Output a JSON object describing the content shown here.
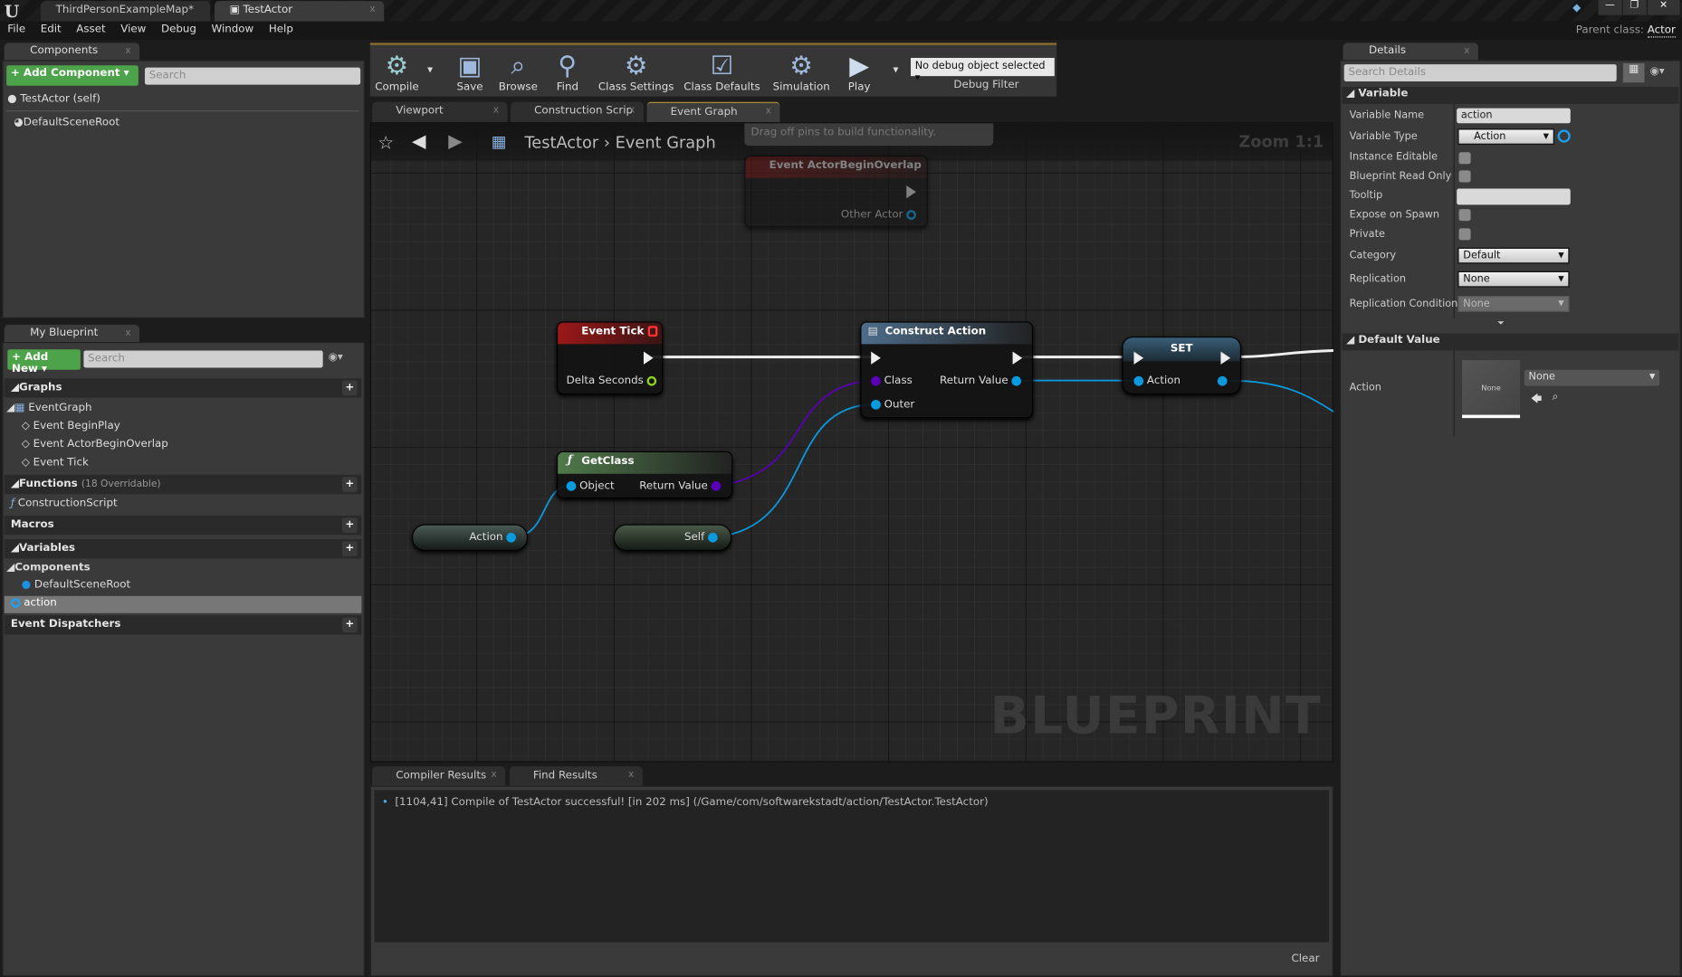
{
  "doc_tabs": [
    {
      "label": "ThirdPersonExampleMap*"
    },
    {
      "label": "TestActor"
    }
  ],
  "menu": [
    "File",
    "Edit",
    "Asset",
    "View",
    "Debug",
    "Window",
    "Help"
  ],
  "parent_class": {
    "label": "Parent class:",
    "value": "Actor"
  },
  "components_panel": {
    "tab": "Components",
    "add_button": "+ Add Component ▾",
    "search_placeholder": "Search",
    "items": [
      "TestActor (self)",
      "DefaultSceneRoot"
    ]
  },
  "toolbar": {
    "compile": "Compile",
    "save": "Save",
    "browse": "Browse",
    "find": "Find",
    "class_settings": "Class Settings",
    "class_defaults": "Class Defaults",
    "simulation": "Simulation",
    "play": "Play",
    "debug_select": "No debug object selected",
    "debug_filter": "Debug Filter"
  },
  "graph_tabs": [
    "Viewport",
    "Construction Scrip",
    "Event Graph"
  ],
  "breadcrumb": {
    "root": "TestActor",
    "current": "Event Graph"
  },
  "zoom": "Zoom 1:1",
  "tooltip": "Drag off pins to build functionality.",
  "watermark": "BLUEPRINT",
  "nodes": {
    "overlap": {
      "title": "Event ActorBeginOverlap",
      "pin": "Other Actor"
    },
    "tick": {
      "title": "Event Tick",
      "pin": "Delta Seconds"
    },
    "construct": {
      "title": "Construct Action",
      "in1": "Class",
      "in2": "Outer",
      "out": "Return Value"
    },
    "set": {
      "title": "SET",
      "pin": "Action"
    },
    "getclass": {
      "title": "GetClass",
      "in": "Object",
      "out": "Return Value"
    },
    "action_get": {
      "label": "Action"
    },
    "self": {
      "label": "Self"
    }
  },
  "my_blueprint": {
    "tab": "My Blueprint",
    "add_button": "+ Add New ▾",
    "search_placeholder": "Search",
    "graphs": "Graphs",
    "event_graph": "EventGraph",
    "events": [
      "Event BeginPlay",
      "Event ActorBeginOverlap",
      "Event Tick"
    ],
    "functions": "Functions",
    "functions_count": "(18 Overridable)",
    "construction_script": "ConstructionScript",
    "macros": "Macros",
    "variables": "Variables",
    "components": "Components",
    "default_scene_root": "DefaultSceneRoot",
    "action_var": "action",
    "event_dispatchers": "Event Dispatchers"
  },
  "results_tabs": [
    "Compiler Results",
    "Find Results"
  ],
  "log": "[1104,41] Compile of TestActor successful! [in 202 ms] (/Game/com/softwarekstadt/action/TestActor.TestActor)",
  "clear": "Clear",
  "details": {
    "tab": "Details",
    "search_placeholder": "Search Details",
    "variable_section": "Variable",
    "rows": {
      "name_label": "Variable Name",
      "name_value": "action",
      "type_label": "Variable Type",
      "type_value": "Action",
      "instance_editable": "Instance Editable",
      "read_only": "Blueprint Read Only",
      "tooltip": "Tooltip",
      "expose": "Expose on Spawn",
      "private": "Private",
      "category_label": "Category",
      "category_value": "Default",
      "replication_label": "Replication",
      "replication_value": "None",
      "rep_cond_label": "Replication Condition",
      "rep_cond_value": "None"
    },
    "default_section": "Default Value",
    "default_label": "Action",
    "thumb": "None",
    "default_value": "None"
  },
  "colors": {
    "exec": "#eeeeee",
    "object": "#00a8f0",
    "class": "#5a00b8",
    "float": "#8ed11b",
    "event": "#8a1a1a",
    "accent_green": "#4da34a"
  }
}
